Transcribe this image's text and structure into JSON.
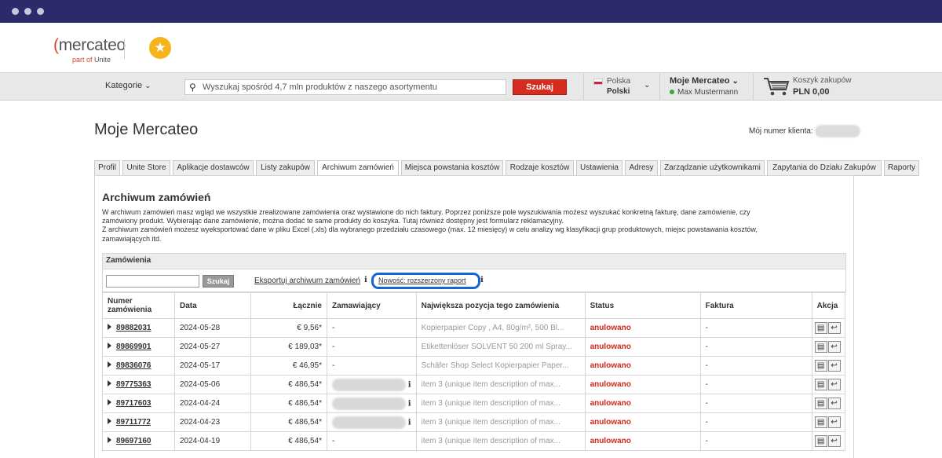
{
  "window": {
    "title_dots": 3
  },
  "logo": {
    "brand": "mercateo",
    "sub_prefix": "part of",
    "sub_brand": "Unite"
  },
  "nav": {
    "categories_label": "Kategorie",
    "search_placeholder": "Wyszukaj spośród 4,7 mln produktów z naszego asortymentu",
    "search_button": "Szukaj",
    "country": "Polska",
    "language": "Polski",
    "account_title": "Moje Mercateo",
    "account_user": "Max Mustermann",
    "cart_label": "Koszyk zakupów",
    "cart_total": "PLN 0,00"
  },
  "page": {
    "title": "Moje Mercateo",
    "customer_number_label": "Mój numer klienta:"
  },
  "tabs": [
    "Profil",
    "Unite Store",
    "Aplikacje dostawców",
    "Listy zakupów",
    "Archiwum zamówień",
    "Miejsca powstania kosztów",
    "Rodzaje kosztów",
    "Ustawienia",
    "Adresy",
    "Zarządzanie użytkownikami",
    "Zapytania do Działu Zakupów",
    "Raporty"
  ],
  "active_tab": "Archiwum zamówień",
  "archive": {
    "heading": "Archiwum zamówień",
    "desc_line1": "W archiwum zamówień masz wgląd we wszystkie zrealizowane zamówienia oraz wystawione do nich faktury. Poprzez poniższe pole wyszukiwania możesz wyszukać konkretną fakturę, dane zamówienie, czy",
    "desc_line2": "zamówiony produkt. Wybierając dane zamówienie, można dodać te same produkty do koszyka. Tutaj również dostępny jest formularz reklamacyjny.",
    "desc_line3": "Z archiwum zamówień możesz wyeksportować dane w pliku Excel (.xls) dla wybranego przedziału czasowego (max. 12 miesięcy) w celu analizy wg klasyfikacji grup produktowych, miejsc powstawania kosztów,",
    "desc_line4": "zamawiających itd.",
    "section_title": "Zamówienia",
    "search_button": "Szukaj",
    "export_link": "Eksportuj archiwum zamówień",
    "new_report_link": "Nowość: rozszerzony raport"
  },
  "table": {
    "headers": [
      "Numer zamówienia",
      "Data",
      "Łącznie",
      "Zamawiający",
      "Największa pozycja tego zamówienia",
      "Status",
      "Faktura",
      "Akcja"
    ],
    "rows": [
      {
        "number": "89882031",
        "date": "2024-05-28",
        "total": "€ 9,56*",
        "orderer": "-",
        "item": "Kopierpapier Copy , A4, 80g/m², 500 Bl...",
        "status": "anulowano",
        "invoice": "-",
        "blurred": false
      },
      {
        "number": "89869901",
        "date": "2024-05-27",
        "total": "€ 189,03*",
        "orderer": "-",
        "item": "Etikettenlöser SOLVENT 50 200 ml Spray...",
        "status": "anulowano",
        "invoice": "-",
        "blurred": false
      },
      {
        "number": "89836076",
        "date": "2024-05-17",
        "total": "€ 46,95*",
        "orderer": "-",
        "item": "Schäfer Shop Select Kopierpapier Paper...",
        "status": "anulowano",
        "invoice": "-",
        "blurred": false
      },
      {
        "number": "89775363",
        "date": "2024-05-06",
        "total": "€ 486,54*",
        "orderer": "",
        "item": "item 3 (unique item description of max...",
        "status": "anulowano",
        "invoice": "-",
        "blurred": true
      },
      {
        "number": "89717603",
        "date": "2024-04-24",
        "total": "€ 486,54*",
        "orderer": "",
        "item": "item 3 (unique item description of max...",
        "status": "anulowano",
        "invoice": "-",
        "blurred": true
      },
      {
        "number": "89711772",
        "date": "2024-04-23",
        "total": "€ 486,54*",
        "orderer": "",
        "item": "item 3 (unique item description of max...",
        "status": "anulowano",
        "invoice": "-",
        "blurred": true
      },
      {
        "number": "89697160",
        "date": "2024-04-19",
        "total": "€ 486,54*",
        "orderer": "-",
        "item": "item 3 (unique item description of max...",
        "status": "anulowano",
        "invoice": "-",
        "blurred": false
      }
    ]
  },
  "colors": {
    "brand_red": "#d52c1f",
    "titlebar": "#2d2a6b",
    "highlight": "#1565d6",
    "status_red": "#d2271a"
  }
}
